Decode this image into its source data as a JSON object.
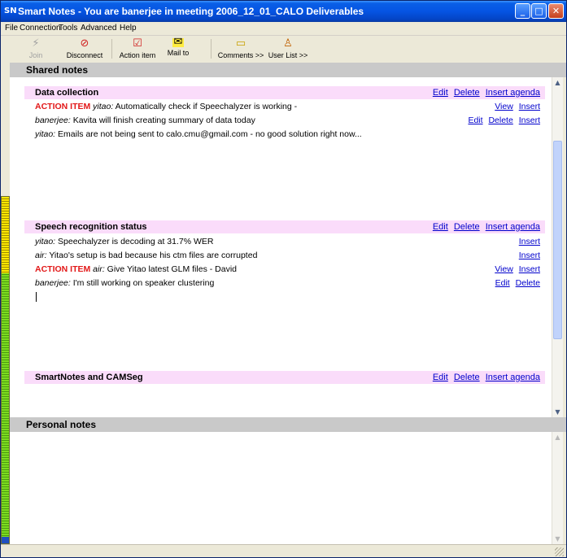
{
  "window": {
    "title": "Smart Notes - You are banerjee in meeting 2006_12_01_CALO Deliverables",
    "icon": "app-icon"
  },
  "menu": [
    "File",
    "Connection",
    "Tools",
    "Advanced",
    "Help"
  ],
  "toolbar": {
    "join": "Join",
    "disconnect": "Disconnect",
    "action_item": "Action item",
    "mail_to": "Mail to",
    "comments": "Comments >>",
    "user_list": "User List >>"
  },
  "shared": {
    "header": "Shared notes",
    "topics": [
      {
        "title": "Data collection",
        "actions": [
          "Edit",
          "Delete",
          "Insert agenda"
        ],
        "notes": [
          {
            "tag": "ACTION ITEM",
            "author": "yitao:",
            "text": " Automatically check if Speechalyzer is working -",
            "actions": [
              "View",
              "Insert"
            ]
          },
          {
            "tag": "",
            "author": "banerjee:",
            "text": " Kavita will finish creating summary of data today",
            "actions": [
              "Edit",
              "Delete",
              "Insert"
            ]
          },
          {
            "tag": "",
            "author": "yitao:",
            "text": " Emails are not being sent to calo.cmu@gmail.com - no good solution right now...",
            "actions": []
          }
        ]
      },
      {
        "title": "Speech recognition status",
        "actions": [
          "Edit",
          "Delete",
          "Insert agenda"
        ],
        "notes": [
          {
            "tag": "",
            "author": "yitao:",
            "text": " Speechalyzer is decoding at 31.7% WER",
            "actions": [
              "Insert"
            ]
          },
          {
            "tag": "",
            "author": "air:",
            "text": " Yitao's setup is bad because his ctm files are corrupted",
            "actions": [
              "Insert"
            ]
          },
          {
            "tag": "ACTION ITEM",
            "author": "air:",
            "text": " Give Yitao latest GLM files - David",
            "actions": [
              "View",
              "Insert"
            ]
          },
          {
            "tag": "",
            "author": "banerjee:",
            "text": " I'm still working on speaker clustering",
            "actions": [
              "Edit",
              "Delete"
            ]
          }
        ]
      },
      {
        "title": "SmartNotes and CAMSeg",
        "actions": [
          "Edit",
          "Delete",
          "Insert agenda"
        ],
        "notes": []
      }
    ]
  },
  "personal": {
    "header": "Personal notes"
  },
  "colors": {
    "topic_bg": "#fadcfa",
    "action_red": "#e21818",
    "link_blue": "#0000cc",
    "header_gray": "#c9c9c9"
  }
}
